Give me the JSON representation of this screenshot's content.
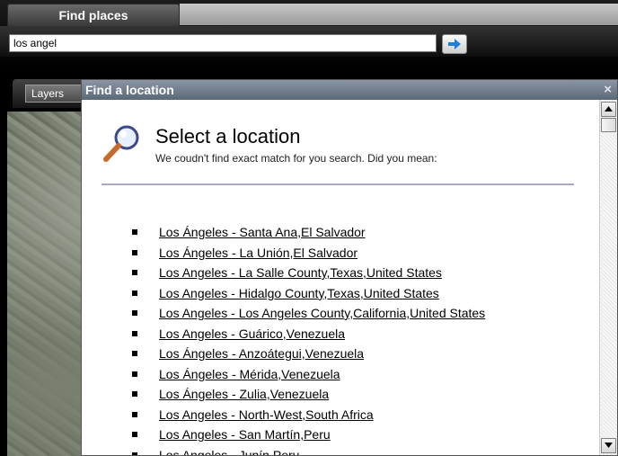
{
  "toolbar": {
    "tab_label": "Find places",
    "search_value": "los angel",
    "go_icon": "arrow-right-icon",
    "layers_label": "Layers"
  },
  "dialog": {
    "title": "Find a location",
    "close_label": "×",
    "heading": "Select a location",
    "subheading": "We coudn't find exact match for you search. Did you mean:",
    "results": [
      "Los Ángeles - Santa Ana,El Salvador",
      "Los Ángeles - La Unión,El Salvador",
      "Los Angeles - La Salle County,Texas,United States",
      "Los Angeles - Hidalgo County,Texas,United States",
      "Los Angeles - Los Angeles County,California,United States",
      "Los Angeles - Guárico,Venezuela",
      "Los Ángeles - Anzoátegui,Venezuela",
      "Los Ángeles - Mérida,Venezuela",
      "Los Ángeles - Zulia,Venezuela",
      "Los Angeles - North-West,South Africa",
      "Los Angeles - San Martín,Peru",
      "Los Angeles - Junín,Peru"
    ]
  },
  "colors": {
    "title_bar": "#6e7a8a",
    "divider": "#a9a9c4",
    "go_arrow": "#1e7fd9"
  }
}
